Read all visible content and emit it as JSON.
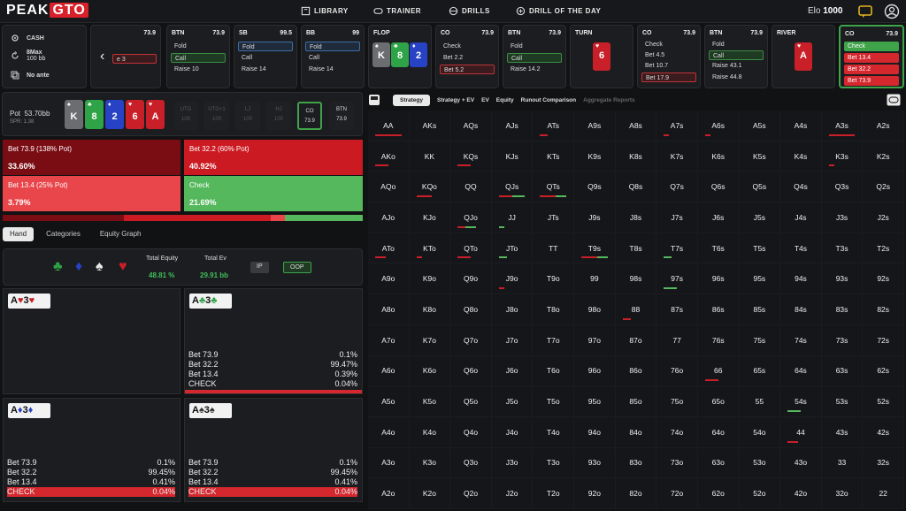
{
  "header": {
    "logo_a": "PEAK",
    "logo_b": "GTO",
    "nav": [
      "LIBRARY",
      "TRAINER",
      "DRILLS",
      "DRILL OF THE DAY"
    ],
    "elo_label": "Elo",
    "elo_value": "1000"
  },
  "game": {
    "type": "CASH",
    "max": "8Max",
    "stack": "100 bb",
    "ante": "No ante"
  },
  "steps": [
    {
      "pos": "",
      "amount": "73.9",
      "actions": [
        {
          "label": "e 3",
          "style": "sel-red"
        }
      ]
    },
    {
      "pos": "BTN",
      "amount": "73.9",
      "actions": [
        {
          "label": "Fold",
          "style": ""
        },
        {
          "label": "Call",
          "style": "sel-green"
        },
        {
          "label": "Raise 10",
          "style": ""
        }
      ]
    },
    {
      "pos": "SB",
      "amount": "99.5",
      "actions": [
        {
          "label": "Fold",
          "style": "sel-blue"
        },
        {
          "label": "Call",
          "style": ""
        },
        {
          "label": "Raise 14",
          "style": ""
        }
      ]
    },
    {
      "pos": "BB",
      "amount": "99",
      "actions": [
        {
          "label": "Fold",
          "style": "sel-blue"
        },
        {
          "label": "Call",
          "style": ""
        },
        {
          "label": "Raise 14",
          "style": ""
        }
      ]
    },
    {
      "pos": "CO",
      "amount": "73.9",
      "actions": [
        {
          "label": "Check",
          "style": ""
        },
        {
          "label": "Bet 2.2",
          "style": ""
        },
        {
          "label": "Bet 5.2",
          "style": "sel-red"
        }
      ]
    },
    {
      "pos": "BTN",
      "amount": "73.9",
      "actions": [
        {
          "label": "Fold",
          "style": ""
        },
        {
          "label": "Call",
          "style": "sel-green"
        },
        {
          "label": "Raise 14.2",
          "style": ""
        }
      ]
    },
    {
      "pos": "CO",
      "amount": "73.9",
      "actions": [
        {
          "label": "Check",
          "style": ""
        },
        {
          "label": "Bet 4.5",
          "style": ""
        },
        {
          "label": "Bet 10.7",
          "style": ""
        },
        {
          "label": "Bet 17.9",
          "style": "sel-red"
        }
      ]
    },
    {
      "pos": "BTN",
      "amount": "73.9",
      "actions": [
        {
          "label": "Fold",
          "style": ""
        },
        {
          "label": "Call",
          "style": "sel-green"
        },
        {
          "label": "Raise 43.1",
          "style": ""
        },
        {
          "label": "Raise 44.8",
          "style": ""
        }
      ]
    },
    {
      "pos": "CO",
      "amount": "73.9",
      "actions": [
        {
          "label": "Check",
          "style": "green-fill"
        },
        {
          "label": "Bet 13.4",
          "style": "red-fill"
        },
        {
          "label": "Bet 32.2",
          "style": "red-fill"
        },
        {
          "label": "Bet 73.9",
          "style": "red-fill"
        }
      ]
    }
  ],
  "streets": {
    "flop": "FLOP",
    "turn": "TURN",
    "river": "RIVER"
  },
  "flop_cards": [
    {
      "rank": "K",
      "suit": "♠",
      "color": "c-grey"
    },
    {
      "rank": "8",
      "suit": "♣",
      "color": "c-green"
    },
    {
      "rank": "2",
      "suit": "♦",
      "color": "c-blue"
    }
  ],
  "turn_card": {
    "rank": "6",
    "suit": "♥"
  },
  "river_card": {
    "rank": "A",
    "suit": "♥"
  },
  "board": {
    "pot_label": "Pot",
    "pot_value": "53.70bb",
    "spr": "SPR: 1.38",
    "cards": [
      {
        "rank": "K",
        "suit": "♠",
        "color": "c-grey"
      },
      {
        "rank": "8",
        "suit": "♣",
        "color": "c-green"
      },
      {
        "rank": "2",
        "suit": "♦",
        "color": "c-blue"
      },
      {
        "rank": "6",
        "suit": "♥",
        "color": "c-red"
      },
      {
        "rank": "A",
        "suit": "♥",
        "color": "c-red"
      }
    ],
    "positions": [
      {
        "name": "UTG",
        "val": "100"
      },
      {
        "name": "UTG+1",
        "val": "100"
      },
      {
        "name": "LJ",
        "val": "100"
      },
      {
        "name": "HJ",
        "val": "100"
      },
      {
        "name": "CO",
        "val": "73.9"
      },
      {
        "name": "BTN",
        "val": "73.9"
      }
    ]
  },
  "freqs": [
    {
      "label": "Bet 73.9 (138% Pot)",
      "pct": "33.60%",
      "color": "fb-dark",
      "color_hex": "#7a0d14",
      "value": 33.6
    },
    {
      "label": "Bet 32.2 (60% Pot)",
      "pct": "40.92%",
      "color": "fb-red",
      "color_hex": "#cc1a22",
      "value": 40.92
    },
    {
      "label": "Bet 13.4 (25% Pot)",
      "pct": "3.79%",
      "color": "fb-light",
      "color_hex": "#e8464b",
      "value": 3.79
    },
    {
      "label": "Check",
      "pct": "21.69%",
      "color": "fb-green",
      "color_hex": "#55b85d",
      "value": 21.69
    }
  ],
  "tabs": [
    "Hand",
    "Categories",
    "Equity Graph"
  ],
  "equity": {
    "total_equity_label": "Total Equity",
    "total_equity": "48.81 %",
    "total_ev_label": "Total Ev",
    "total_ev": "29.91 bb",
    "ip": "IP",
    "oop": "OOP"
  },
  "combos": [
    {
      "r1": "A",
      "s1": "♥",
      "r2": "3",
      "s2": "♥",
      "color": "#c91f28",
      "rows": []
    },
    {
      "r1": "A",
      "s1": "♣",
      "r2": "3",
      "s2": "♣",
      "color": "#2fa347",
      "rows": [
        [
          "Bet 73.9",
          "0.1%"
        ],
        [
          "Bet 32.2",
          "99.47%"
        ],
        [
          "Bet 13.4",
          "0.39%"
        ],
        [
          "CHECK",
          "0.04%"
        ]
      ]
    },
    {
      "r1": "A",
      "s1": "♦",
      "r2": "3",
      "s2": "♦",
      "color": "#2742c4",
      "rows": [
        [
          "Bet 73.9",
          "0.1%"
        ],
        [
          "Bet 32.2",
          "99.45%"
        ],
        [
          "Bet 13.4",
          "0.41%"
        ],
        [
          "CHECK",
          "0.04%"
        ]
      ]
    },
    {
      "r1": "A",
      "s1": "♠",
      "r2": "3",
      "s2": "♠",
      "color": "#555",
      "rows": [
        [
          "Bet 73.9",
          "0.1%"
        ],
        [
          "Bet 32.2",
          "99.45%"
        ],
        [
          "Bet 13.4",
          "0.41%"
        ],
        [
          "CHECK",
          "0.04%"
        ]
      ]
    }
  ],
  "grid_tabs": [
    "Strategy",
    "Strategy + EV",
    "EV",
    "Equity",
    "Runout Comparison",
    "Aggregate Reports"
  ],
  "grid": {
    "ranks": [
      "A",
      "K",
      "Q",
      "J",
      "T",
      "9",
      "8",
      "7",
      "6",
      "5",
      "4",
      "3",
      "2"
    ],
    "colored": {
      "AA": [
        [
          "#c91f28",
          1
        ]
      ],
      "A3s": [
        [
          "#c91f28",
          1
        ]
      ],
      "ATs": [
        [
          "#c91f28",
          0.3
        ]
      ],
      "AKo": [
        [
          "#c91f28",
          0.5
        ]
      ],
      "KQo": [
        [
          "#c91f28",
          0.6
        ]
      ],
      "QJs": [
        [
          "#c91f28",
          0.5
        ],
        [
          "#55b85d",
          0.5
        ]
      ],
      "QTs": [
        [
          "#c91f28",
          0.6
        ],
        [
          "#55b85d",
          0.4
        ]
      ],
      "KQs": [
        [
          "#c91f28",
          0.5
        ]
      ],
      "A7s": [
        [
          "#c91f28",
          0.2
        ]
      ],
      "QJo": [
        [
          "#c91f28",
          0.3
        ],
        [
          "#55b85d",
          0.4
        ]
      ],
      "ATo": [
        [
          "#c91f28",
          0.4
        ]
      ],
      "KTo": [
        [
          "#c91f28",
          0.2
        ]
      ],
      "QTo": [
        [
          "#c91f28",
          0.5
        ]
      ],
      "JTo": [
        [
          "#55b85d",
          0.3
        ]
      ],
      "T9s": [
        [
          "#c91f28",
          0.6
        ],
        [
          "#55b85d",
          0.4
        ]
      ],
      "T7s": [
        [
          "#55b85d",
          0.3
        ]
      ],
      "97s": [
        [
          "#55b85d",
          0.5
        ]
      ],
      "88": [
        [
          "#c91f28",
          0.3
        ]
      ],
      "66": [
        [
          "#c91f28",
          0.5
        ]
      ],
      "54s": [
        [
          "#55b85d",
          0.5
        ]
      ],
      "44": [
        [
          "#c91f28",
          0.4
        ]
      ],
      "A6s": [
        [
          "#c91f28",
          0.2
        ]
      ],
      "K3s": [
        [
          "#c91f28",
          0.2
        ]
      ],
      "JJ": [
        [
          "#55b85d",
          0.2
        ]
      ],
      "J9o": [
        [
          "#c91f28",
          0.2
        ]
      ]
    }
  }
}
